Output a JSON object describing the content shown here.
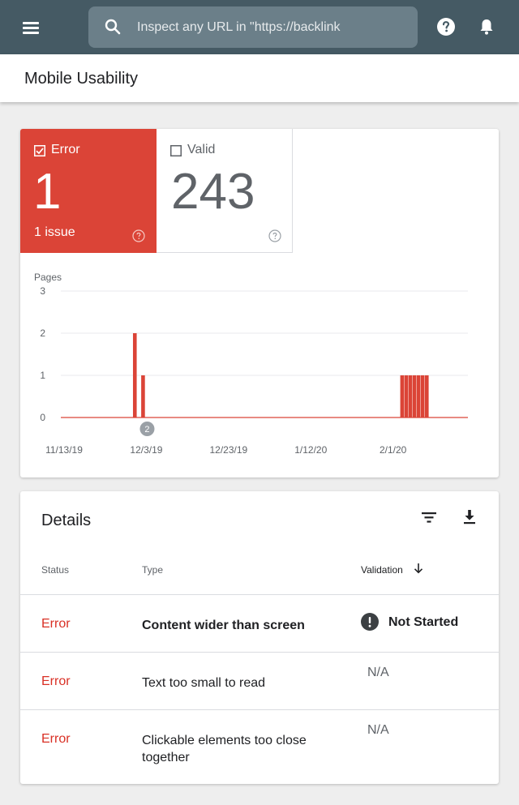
{
  "header": {
    "search_placeholder": "Inspect any URL in \"https://backlink",
    "icons": [
      "menu-icon",
      "search-icon",
      "help-icon",
      "notifications-icon"
    ]
  },
  "page": {
    "title": "Mobile Usability"
  },
  "summary": {
    "error": {
      "label": "Error",
      "value": "1",
      "sub": "1 issue",
      "checked": true,
      "color": "#db4437"
    },
    "valid": {
      "label": "Valid",
      "value": "243",
      "checked": false
    }
  },
  "chart_data": {
    "type": "bar",
    "ylabel": "Pages",
    "xlabel": "",
    "ylim": [
      0,
      3
    ],
    "yticks": [
      "3",
      "2",
      "1",
      "0"
    ],
    "xtick_labels": [
      "11/13/19",
      "12/3/19",
      "12/23/19",
      "1/12/20",
      "2/1/20"
    ],
    "x_start": "2019-11-13",
    "x_end": "2020-02-20",
    "series": [
      {
        "color": "#db4437",
        "points": [
          {
            "x": "2019-12-01",
            "y": 2
          },
          {
            "x": "2019-12-03",
            "y": 1
          },
          {
            "x": "2020-02-04",
            "y": 1
          },
          {
            "x": "2020-02-05",
            "y": 1
          },
          {
            "x": "2020-02-06",
            "y": 1
          },
          {
            "x": "2020-02-07",
            "y": 1
          },
          {
            "x": "2020-02-08",
            "y": 1
          },
          {
            "x": "2020-02-09",
            "y": 1
          },
          {
            "x": "2020-02-10",
            "y": 1
          }
        ]
      }
    ],
    "annotations": [
      {
        "x": "2019-12-04",
        "label": "2"
      }
    ]
  },
  "details": {
    "title": "Details",
    "columns": {
      "status": "Status",
      "type": "Type",
      "validation": "Validation"
    },
    "rows": [
      {
        "status": "Error",
        "type": "Content wider than screen",
        "validation": "Not Started"
      },
      {
        "status": "Error",
        "type": "Text too small to read",
        "validation": "N/A"
      },
      {
        "status": "Error",
        "type": "Clickable elements too close together",
        "validation": "N/A"
      }
    ]
  }
}
